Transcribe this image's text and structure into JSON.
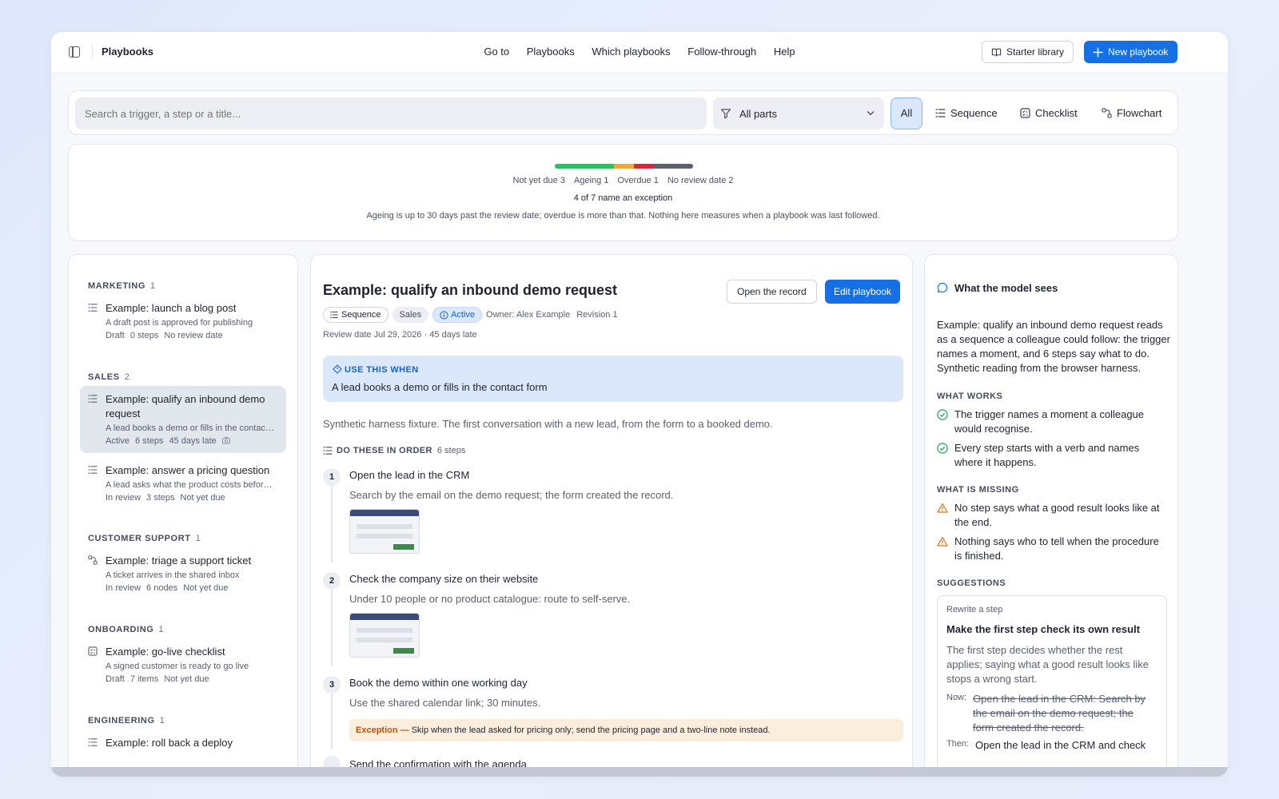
{
  "app": {
    "title": "Playbooks",
    "nav": [
      "Go to",
      "Playbooks",
      "Which playbooks",
      "Follow-through",
      "Help"
    ],
    "starter_label": "Starter library",
    "new_label": "New playbook",
    "accent": "#1570e6"
  },
  "search": {
    "placeholder": "Search a trigger, a step or a title...",
    "parts_label": "All parts",
    "view_all": "All",
    "views": [
      "Sequence",
      "Checklist",
      "Flowchart"
    ]
  },
  "summary": {
    "segments": [
      {
        "label": "Not yet due",
        "count": 3,
        "color": "#22c55e"
      },
      {
        "label": "Ageing",
        "count": 1,
        "color": "#f0a830"
      },
      {
        "label": "Overdue",
        "count": 1,
        "color": "#dc2635"
      },
      {
        "label": "No review date",
        "count": 2,
        "color": "#5b606d"
      }
    ],
    "legend": [
      "Not yet due 3",
      "Ageing 1",
      "Overdue 1",
      "No review date 2"
    ],
    "exception_line": "4 of 7 name an exception",
    "note": "Ageing is up to 30 days past the review date; overdue is more than that. Nothing here measures when a playbook was last followed."
  },
  "groups": [
    {
      "name": "MARKETING",
      "count": "1"
    },
    {
      "name": "SALES",
      "count": "2"
    },
    {
      "name": "CUSTOMER SUPPORT",
      "count": "1"
    },
    {
      "name": "ONBOARDING",
      "count": "1"
    },
    {
      "name": "ENGINEERING",
      "count": "1"
    }
  ],
  "playbooks": [
    {
      "title": "Example: launch a blog post",
      "desc": "A draft post is approved for publishing",
      "meta": [
        "Draft",
        "0 steps",
        "No review date"
      ],
      "icon": "sequence-icon"
    },
    {
      "title": "Example: qualify an inbound demo request",
      "desc": "A lead books a demo or fills in the contact form",
      "meta": [
        "Active",
        "6 steps",
        "45 days late"
      ],
      "icon": "sequence-icon"
    },
    {
      "title": "Example: answer a pricing question",
      "desc": "A lead asks what the product costs before booking a demo",
      "meta": [
        "In review",
        "3 steps",
        "Not yet due"
      ],
      "icon": "sequence-icon"
    },
    {
      "title": "Example: triage a support ticket",
      "desc": "A ticket arrives in the shared inbox",
      "meta": [
        "In review",
        "6 nodes",
        "Not yet due"
      ],
      "icon": "flowchart-icon"
    },
    {
      "title": "Example: go-live checklist",
      "desc": "A signed customer is ready to go live",
      "meta": [
        "Draft",
        "7 items",
        "Not yet due"
      ],
      "icon": "checklist-icon"
    },
    {
      "title": "Example: roll back a deploy",
      "desc": "",
      "meta": [],
      "icon": "sequence-icon"
    }
  ],
  "detail": {
    "title": "Example: qualify an inbound demo request",
    "open_label": "Open the record",
    "edit_label": "Edit playbook",
    "type_chip": "Sequence",
    "team_chip": "Sales",
    "status_chip": "Active",
    "owner": "Owner: Alex Example",
    "revision": "Revision 1",
    "review": "Review date Jul 29, 2026 · 45 days late",
    "use_label": "USE THIS WHEN",
    "use_text": "A lead books a demo or fills in the contact form",
    "description": "Synthetic harness fixture. The first conversation with a new lead, from the form to a booked demo.",
    "order_label": "DO THESE IN ORDER",
    "order_count": "6 steps",
    "steps": [
      {
        "num": "1",
        "title": "Open the lead in the CRM",
        "desc": "Search by the email on the demo request; the form created the record."
      },
      {
        "num": "2",
        "title": "Check the company size on their website",
        "desc": "Under 10 people or no product catalogue: route to self-serve."
      },
      {
        "num": "3",
        "title": "Book the demo within one working day",
        "desc": "Use the shared calendar link; 30 minutes."
      }
    ],
    "exception_label": "Exception —",
    "exception_text": "Skip when the lead asked for pricing only; send the pricing page and a two-line note instead.",
    "step4_partial": "Send the confirmation with the agenda"
  },
  "model": {
    "heading": "What the model sees",
    "paragraph": "Example: qualify an inbound demo request reads as a sequence a colleague could follow: the trigger names a moment, and 6 steps say what to do. Synthetic reading from the browser harness.",
    "works_label": "WHAT WORKS",
    "works": [
      "The trigger names a moment a colleague would recognise.",
      "Every step starts with a verb and names where it happens."
    ],
    "missing_label": "WHAT IS MISSING",
    "missing": [
      "No step says what a good result looks like at the end.",
      "Nothing says who to tell when the procedure is finished."
    ],
    "suggestions_label": "SUGGESTIONS",
    "suggestion": {
      "kind": "Rewrite a step",
      "title": "Make the first step check its own result",
      "body": "The first step decides whether the rest applies; saying what a good result looks like stops a wrong start.",
      "now_label": "Now:",
      "now": "Open the lead in the CRM: Search by the email on the demo request; the form created the record.",
      "then_label": "Then:",
      "then": "Open the lead in the CRM and check"
    }
  }
}
